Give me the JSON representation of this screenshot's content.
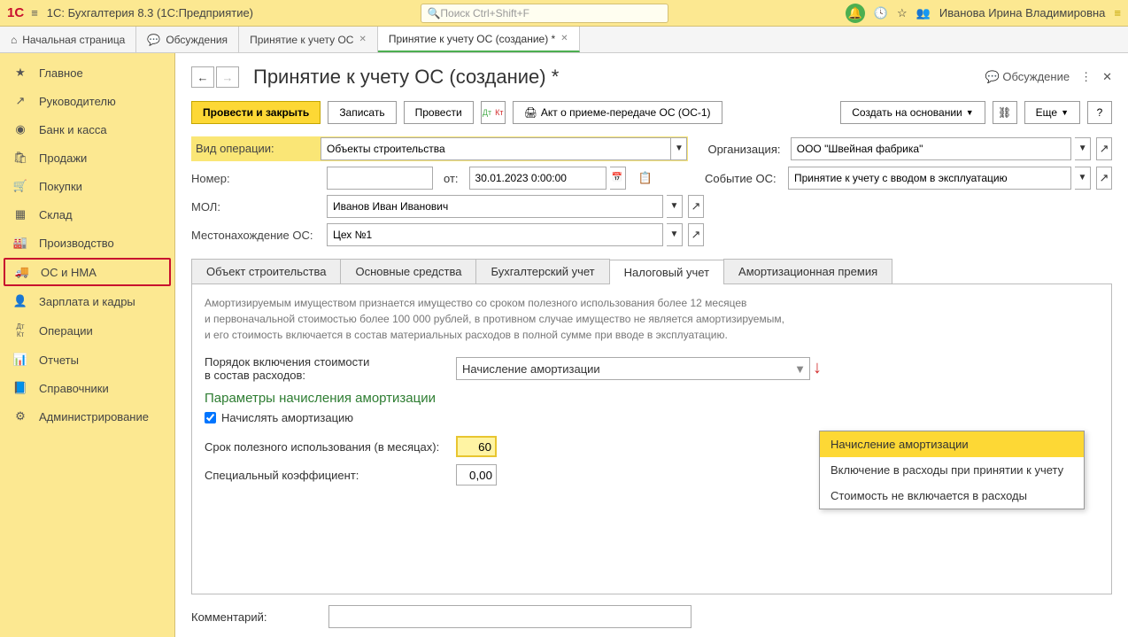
{
  "topBar": {
    "appTitle": "1С: Бухгалтерия 8.3  (1С:Предприятие)",
    "searchPlaceholder": "Поиск Ctrl+Shift+F",
    "userName": "Иванова Ирина Владимировна"
  },
  "tabs": [
    {
      "label": "Начальная страница",
      "closable": false
    },
    {
      "label": "Обсуждения",
      "closable": false
    },
    {
      "label": "Принятие к учету ОС",
      "closable": true
    },
    {
      "label": "Принятие к учету ОС (создание) *",
      "closable": true,
      "active": true
    }
  ],
  "sidebar": [
    {
      "label": "Главное",
      "icon": "★"
    },
    {
      "label": "Руководителю",
      "icon": "↗"
    },
    {
      "label": "Банк и касса",
      "icon": "◉"
    },
    {
      "label": "Продажи",
      "icon": "🛍"
    },
    {
      "label": "Покупки",
      "icon": "🛒"
    },
    {
      "label": "Склад",
      "icon": "▦"
    },
    {
      "label": "Производство",
      "icon": "🏭"
    },
    {
      "label": "ОС и НМА",
      "icon": "🚚",
      "selected": true
    },
    {
      "label": "Зарплата и кадры",
      "icon": "👤"
    },
    {
      "label": "Операции",
      "icon": "Дт Кт"
    },
    {
      "label": "Отчеты",
      "icon": "📊"
    },
    {
      "label": "Справочники",
      "icon": "📘"
    },
    {
      "label": "Администрирование",
      "icon": "⚙"
    }
  ],
  "page": {
    "title": "Принятие к учету ОС (создание) *",
    "discuss": "Обсуждение"
  },
  "toolbar": {
    "postClose": "Провести и закрыть",
    "write": "Записать",
    "post": "Провести",
    "act": "Акт о приеме-передаче ОС (ОС-1)",
    "createBased": "Создать на основании",
    "more": "Еще",
    "help": "?"
  },
  "form": {
    "vidOperLabel": "Вид операции:",
    "vidOperValue": "Объекты строительства",
    "orgLabel": "Организация:",
    "orgValue": "ООО \"Швейная фабрика\"",
    "numberLabel": "Номер:",
    "fromLabel": "от:",
    "dateValue": "30.01.2023 0:00:00",
    "eventLabel": "Событие ОС:",
    "eventValue": "Принятие к учету с вводом в эксплуатацию",
    "molLabel": "МОЛ:",
    "molValue": "Иванов Иван Иванович",
    "locLabel": "Местонахождение ОС:",
    "locValue": "Цех №1"
  },
  "subtabs": [
    {
      "label": "Объект строительства"
    },
    {
      "label": "Основные средства"
    },
    {
      "label": "Бухгалтерский учет"
    },
    {
      "label": "Налоговый учет",
      "active": true
    },
    {
      "label": "Амортизационная премия"
    }
  ],
  "tax": {
    "info1": "Амортизируемым имуществом признается имущество со сроком полезного использования более 12 месяцев",
    "info2": "и первоначальной стоимостью более 100 000 рублей, в противном случае имущество не является амортизируемым,",
    "info3": "и его стоимость включается в состав материальных расходов в полной сумме при вводе в эксплуатацию.",
    "orderLabel1": "Порядок включения стоимости",
    "orderLabel2": "в состав расходов:",
    "orderValue": "Начисление амортизации",
    "sectionTitle": "Параметры начисления амортизации",
    "chkLabel": "Начислять амортизацию",
    "srokLabel": "Срок полезного использования (в месяцах):",
    "srokValue": "60",
    "koefLabel": "Специальный коэффициент:",
    "koefValue": "0,00"
  },
  "dropdown": [
    {
      "label": "Начисление амортизации",
      "hl": true
    },
    {
      "label": "Включение в расходы при принятии к учету"
    },
    {
      "label": "Стоимость не включается в расходы"
    }
  ],
  "commentLabel": "Комментарий:"
}
